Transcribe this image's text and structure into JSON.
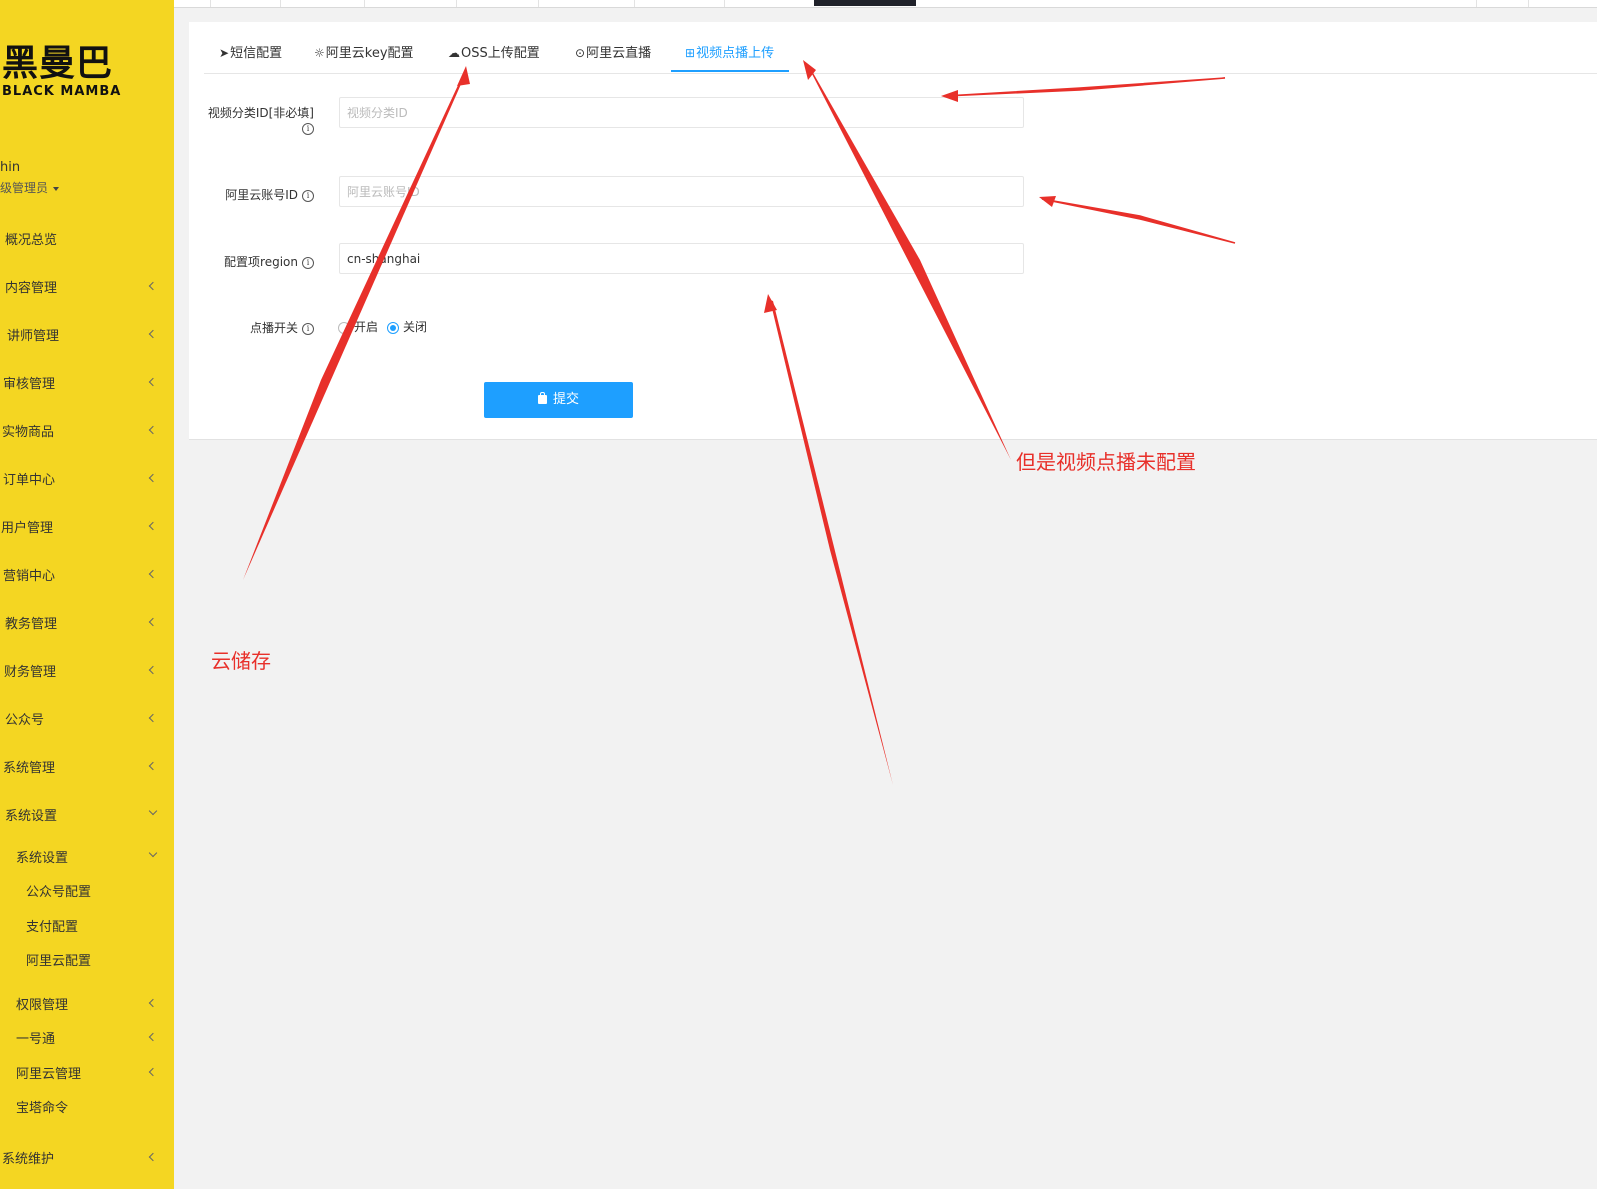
{
  "brand": {
    "logo_cn": "黑曼巴",
    "logo_en": "BLACK MAMBA"
  },
  "user": {
    "name": "hin",
    "role": "级管理员"
  },
  "sidebar": {
    "items": [
      {
        "label": "概况总览",
        "chevron": "none"
      },
      {
        "label": "内容管理",
        "chevron": "left"
      },
      {
        "label": "讲师管理",
        "chevron": "left"
      },
      {
        "label": "审核管理",
        "chevron": "left"
      },
      {
        "label": "实物商品",
        "chevron": "left"
      },
      {
        "label": "订单中心",
        "chevron": "left"
      },
      {
        "label": "用户管理",
        "chevron": "left"
      },
      {
        "label": "营销中心",
        "chevron": "left"
      },
      {
        "label": "教务管理",
        "chevron": "left"
      },
      {
        "label": "财务管理",
        "chevron": "left"
      },
      {
        "label": "公众号",
        "chevron": "left"
      },
      {
        "label": "系统管理",
        "chevron": "left"
      },
      {
        "label": "系统设置",
        "chevron": "down"
      }
    ],
    "sub_items": [
      {
        "label": "系统设置",
        "chevron": "down"
      },
      {
        "label": "公众号配置",
        "chevron": "none"
      },
      {
        "label": "支付配置",
        "chevron": "none"
      },
      {
        "label": "阿里云配置",
        "chevron": "none"
      },
      {
        "label": "权限管理",
        "chevron": "left"
      },
      {
        "label": "一号通",
        "chevron": "left"
      },
      {
        "label": "阿里云管理",
        "chevron": "left"
      },
      {
        "label": "宝塔命令",
        "chevron": "none"
      },
      {
        "label": "系统维护",
        "chevron": "left"
      }
    ]
  },
  "tabs": [
    {
      "label": "短信配置",
      "icon": "paper-plane-icon",
      "glyph": "➤"
    },
    {
      "label": "阿里云key配置",
      "icon": "gear-icon",
      "glyph": "☼"
    },
    {
      "label": "OSS上传配置",
      "icon": "cloud-upload-icon",
      "glyph": "☁"
    },
    {
      "label": "阿里云直播",
      "icon": "play-circle-icon",
      "glyph": "⊙"
    },
    {
      "label": "视频点播上传",
      "icon": "grid-plus-icon",
      "glyph": "⊞",
      "active": true
    }
  ],
  "form": {
    "video_category": {
      "label": "视频分类ID[非必填]",
      "placeholder": "视频分类ID",
      "value": ""
    },
    "aliyun_account": {
      "label": "阿里云账号ID",
      "placeholder": "阿里云账号ID",
      "value": ""
    },
    "region": {
      "label": "配置项region",
      "placeholder": "",
      "value": "cn-shanghai"
    },
    "vod_switch": {
      "label": "点播开关",
      "options": [
        "开启",
        "关闭"
      ],
      "selected": "关闭"
    },
    "submit_label": "提交"
  },
  "annotations": {
    "cloud_storage": "云储存",
    "vod_not_configured": "但是视频点播未配置"
  },
  "colors": {
    "sidebar_bg": "#f4d622",
    "accent": "#1e9fff",
    "annotation": "#e8302a"
  }
}
